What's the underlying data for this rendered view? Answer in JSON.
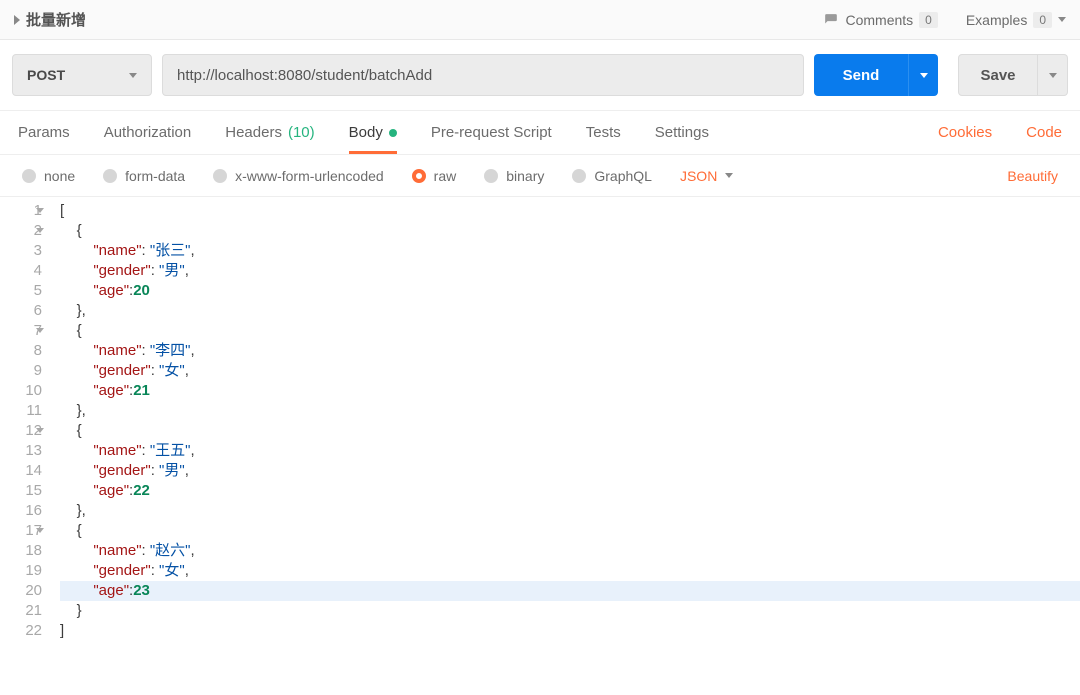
{
  "header": {
    "title": "批量新增",
    "comments_label": "Comments",
    "comments_count": "0",
    "examples_label": "Examples",
    "examples_count": "0"
  },
  "request": {
    "method": "POST",
    "url": "http://localhost:8080/student/batchAdd",
    "send_label": "Send",
    "save_label": "Save"
  },
  "tabs": {
    "params": "Params",
    "authorization": "Authorization",
    "headers": "Headers",
    "headers_count": "(10)",
    "body": "Body",
    "prerequest": "Pre-request Script",
    "tests": "Tests",
    "settings": "Settings",
    "cookies": "Cookies",
    "code": "Code"
  },
  "body_opts": {
    "none": "none",
    "formdata": "form-data",
    "xwww": "x-www-form-urlencoded",
    "raw": "raw",
    "binary": "binary",
    "graphql": "GraphQL",
    "type": "JSON",
    "beautify": "Beautify"
  },
  "editor": {
    "highlight_line": 20,
    "fold_lines": [
      1,
      2,
      7,
      12,
      17
    ],
    "lines": [
      {
        "n": 1,
        "t": [
          {
            "c": "p",
            "v": "["
          }
        ]
      },
      {
        "n": 2,
        "t": [
          {
            "c": "p",
            "v": "    {"
          }
        ]
      },
      {
        "n": 3,
        "t": [
          {
            "c": "p",
            "v": "        "
          },
          {
            "c": "k",
            "v": "\"name\""
          },
          {
            "c": "p",
            "v": ": "
          },
          {
            "c": "s",
            "v": "\"张三\""
          },
          {
            "c": "p",
            "v": ","
          }
        ]
      },
      {
        "n": 4,
        "t": [
          {
            "c": "p",
            "v": "        "
          },
          {
            "c": "k",
            "v": "\"gender\""
          },
          {
            "c": "p",
            "v": ": "
          },
          {
            "c": "s",
            "v": "\"男\""
          },
          {
            "c": "p",
            "v": ","
          }
        ]
      },
      {
        "n": 5,
        "t": [
          {
            "c": "p",
            "v": "        "
          },
          {
            "c": "k",
            "v": "\"age\""
          },
          {
            "c": "p",
            "v": ":"
          },
          {
            "c": "n",
            "v": "20"
          }
        ]
      },
      {
        "n": 6,
        "t": [
          {
            "c": "p",
            "v": "    },"
          }
        ]
      },
      {
        "n": 7,
        "t": [
          {
            "c": "p",
            "v": "    {"
          }
        ]
      },
      {
        "n": 8,
        "t": [
          {
            "c": "p",
            "v": "        "
          },
          {
            "c": "k",
            "v": "\"name\""
          },
          {
            "c": "p",
            "v": ": "
          },
          {
            "c": "s",
            "v": "\"李四\""
          },
          {
            "c": "p",
            "v": ","
          }
        ]
      },
      {
        "n": 9,
        "t": [
          {
            "c": "p",
            "v": "        "
          },
          {
            "c": "k",
            "v": "\"gender\""
          },
          {
            "c": "p",
            "v": ": "
          },
          {
            "c": "s",
            "v": "\"女\""
          },
          {
            "c": "p",
            "v": ","
          }
        ]
      },
      {
        "n": 10,
        "t": [
          {
            "c": "p",
            "v": "        "
          },
          {
            "c": "k",
            "v": "\"age\""
          },
          {
            "c": "p",
            "v": ":"
          },
          {
            "c": "n",
            "v": "21"
          }
        ]
      },
      {
        "n": 11,
        "t": [
          {
            "c": "p",
            "v": "    },"
          }
        ]
      },
      {
        "n": 12,
        "t": [
          {
            "c": "p",
            "v": "    {"
          }
        ]
      },
      {
        "n": 13,
        "t": [
          {
            "c": "p",
            "v": "        "
          },
          {
            "c": "k",
            "v": "\"name\""
          },
          {
            "c": "p",
            "v": ": "
          },
          {
            "c": "s",
            "v": "\"王五\""
          },
          {
            "c": "p",
            "v": ","
          }
        ]
      },
      {
        "n": 14,
        "t": [
          {
            "c": "p",
            "v": "        "
          },
          {
            "c": "k",
            "v": "\"gender\""
          },
          {
            "c": "p",
            "v": ": "
          },
          {
            "c": "s",
            "v": "\"男\""
          },
          {
            "c": "p",
            "v": ","
          }
        ]
      },
      {
        "n": 15,
        "t": [
          {
            "c": "p",
            "v": "        "
          },
          {
            "c": "k",
            "v": "\"age\""
          },
          {
            "c": "p",
            "v": ":"
          },
          {
            "c": "n",
            "v": "22"
          }
        ]
      },
      {
        "n": 16,
        "t": [
          {
            "c": "p",
            "v": "    },"
          }
        ]
      },
      {
        "n": 17,
        "t": [
          {
            "c": "p",
            "v": "    {"
          }
        ]
      },
      {
        "n": 18,
        "t": [
          {
            "c": "p",
            "v": "        "
          },
          {
            "c": "k",
            "v": "\"name\""
          },
          {
            "c": "p",
            "v": ": "
          },
          {
            "c": "s",
            "v": "\"赵六\""
          },
          {
            "c": "p",
            "v": ","
          }
        ]
      },
      {
        "n": 19,
        "t": [
          {
            "c": "p",
            "v": "        "
          },
          {
            "c": "k",
            "v": "\"gender\""
          },
          {
            "c": "p",
            "v": ": "
          },
          {
            "c": "s",
            "v": "\"女\""
          },
          {
            "c": "p",
            "v": ","
          }
        ]
      },
      {
        "n": 20,
        "t": [
          {
            "c": "p",
            "v": "        "
          },
          {
            "c": "k",
            "v": "\"age\""
          },
          {
            "c": "p",
            "v": ":"
          },
          {
            "c": "n",
            "v": "23"
          }
        ]
      },
      {
        "n": 21,
        "t": [
          {
            "c": "p",
            "v": "    }"
          }
        ]
      },
      {
        "n": 22,
        "t": [
          {
            "c": "p",
            "v": "]"
          }
        ]
      }
    ]
  }
}
